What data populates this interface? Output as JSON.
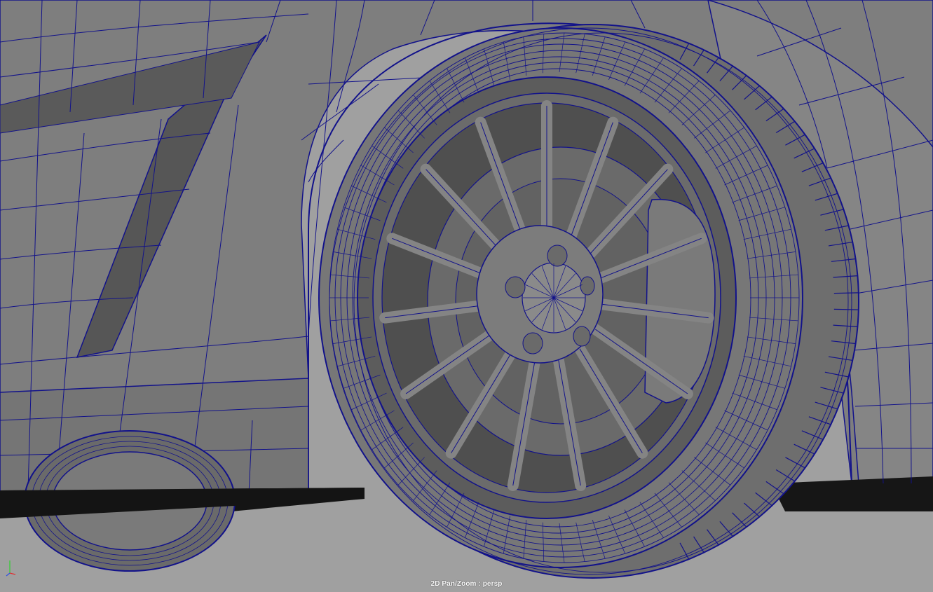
{
  "viewport": {
    "hud_label": "2D Pan/Zoom : persp",
    "camera_name": "persp",
    "display_mode": "wireframe-on-shaded"
  },
  "gizmo": {
    "axes": [
      "x",
      "y",
      "z"
    ],
    "icon": "axis-gizmo-icon"
  },
  "colors": {
    "background": "#a0a0a0",
    "surface": "#7f7f7f",
    "surface_dark": "#5e5e5e",
    "surface_light": "#8c8c8c",
    "shadow": "#1a1a1a",
    "wireframe": "#12128a",
    "axis_x": "#e03030",
    "axis_y": "#30d030",
    "axis_z": "#3050e0"
  }
}
